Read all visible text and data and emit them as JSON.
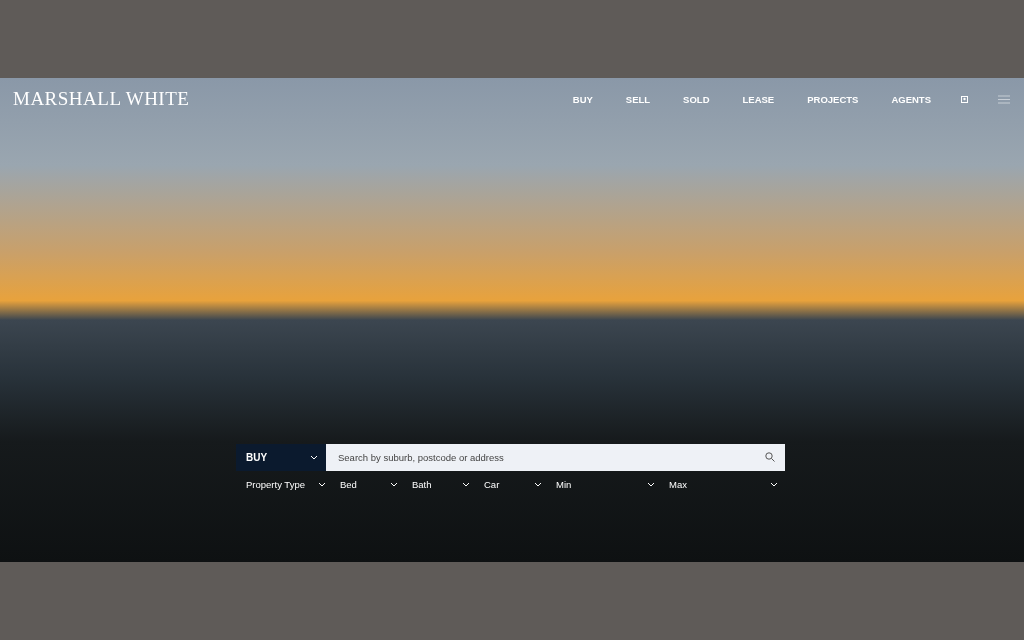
{
  "brand": {
    "logo": "MARSHALL WHITE"
  },
  "nav": [
    {
      "label": "BUY"
    },
    {
      "label": "SELL"
    },
    {
      "label": "SOLD"
    },
    {
      "label": "LEASE"
    },
    {
      "label": "PROJECTS"
    },
    {
      "label": "AGENTS"
    }
  ],
  "search": {
    "mode": "BUY",
    "placeholder": "Search by suburb, postcode or address"
  },
  "filters": [
    {
      "label": "Property Type"
    },
    {
      "label": "Bed"
    },
    {
      "label": "Bath"
    },
    {
      "label": "Car"
    },
    {
      "label": "Min"
    },
    {
      "label": "Max"
    }
  ]
}
